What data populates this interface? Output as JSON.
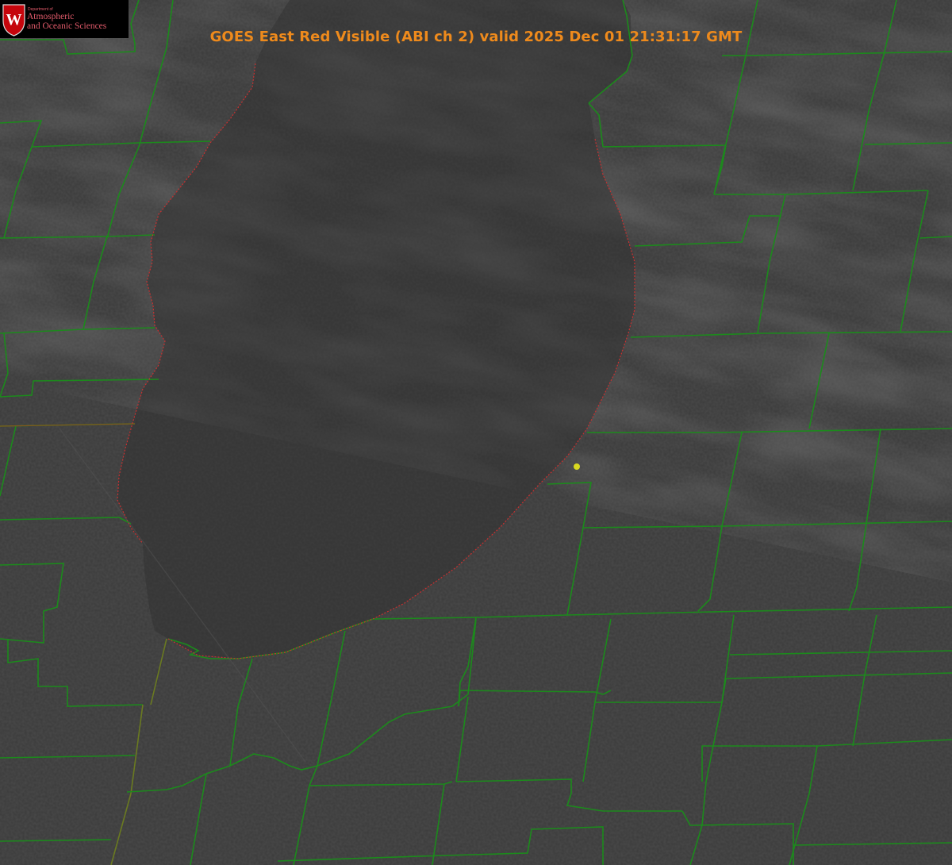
{
  "map": {
    "title": "GOES East Red Visible (ABI ch 2) valid 2025 Dec 01 21:31:17 GMT",
    "background_color": "#3a3a3a",
    "county_border_color": "#1c8a1c",
    "state_border_color": "#c83030",
    "marker_color": "#d8d820",
    "logo": {
      "dept_label": "Department of",
      "line1": "Atmospheric",
      "line2": "and Oceanic Sciences",
      "crest_letter": "W",
      "text_color": "#e05a6a",
      "crest_color": "#c5050c"
    }
  }
}
